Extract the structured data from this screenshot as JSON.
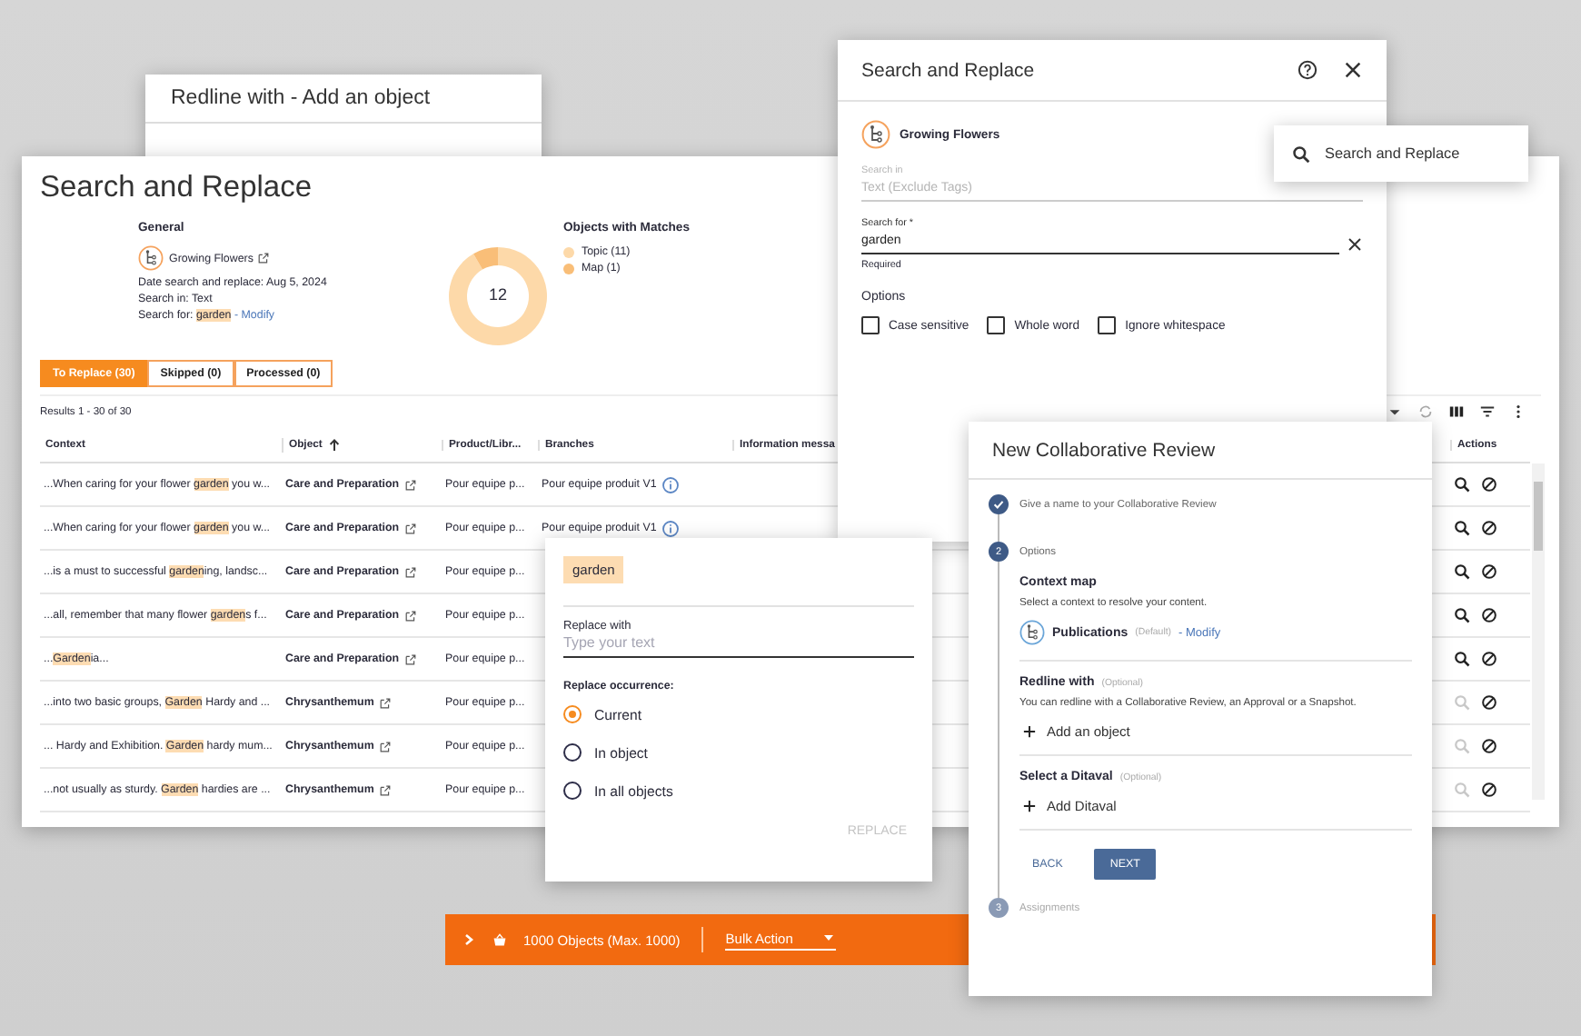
{
  "background_window": {
    "title": "Redline with - Add an object"
  },
  "main": {
    "title": "Search and Replace",
    "general": {
      "heading": "General",
      "map_name": "Growing Flowers",
      "date_line": "Date search and replace: Aug 5, 2024",
      "search_in_line": "Search in: Text",
      "search_for_label": "Search for:",
      "search_for_term": "garden",
      "modify_link": "- Modify"
    },
    "matches": {
      "heading": "Objects with Matches",
      "total": "12",
      "legend": [
        {
          "color": "#fdd9a9"
        },
        {
          "color": "#f9be78"
        }
      ],
      "chart_data": {
        "type": "donut",
        "categories": [
          "Topic (11)",
          "Map (1)"
        ],
        "series": [
          {
            "values": [
              11,
              1
            ]
          }
        ]
      }
    },
    "tabs": [
      {
        "label": "To Replace (30)",
        "selected": true
      },
      {
        "label": "Skipped (0)",
        "selected": false
      },
      {
        "label": "Processed (0)",
        "selected": false
      }
    ],
    "results": "Results 1 - 30 of 30",
    "table": {
      "columns": [
        {
          "label": "Context",
          "sorted": false
        },
        {
          "label": "Object",
          "sorted": true
        },
        {
          "label": "Product/Libr...",
          "sorted": false
        },
        {
          "label": "Branches",
          "sorted": false
        },
        {
          "label": "Information messa",
          "sorted": false
        },
        {
          "label": "Actions",
          "sorted": false
        }
      ],
      "rows": [
        {
          "context": [
            {
              "text": "...When caring for your flower ",
              "highlight": false
            },
            {
              "text": "garden",
              "highlight": true
            },
            {
              "text": " you w...",
              "highlight": false
            }
          ],
          "object": "Care and Preparation",
          "product": "Pour equipe p...",
          "branch": "Pour equipe produit V1",
          "preview_enabled": true
        },
        {
          "context": [
            {
              "text": "...When caring for your flower ",
              "highlight": false
            },
            {
              "text": "garden",
              "highlight": true
            },
            {
              "text": " you w...",
              "highlight": false
            }
          ],
          "object": "Care and Preparation",
          "product": "Pour equipe p...",
          "branch": "Pour equipe produit V1",
          "preview_enabled": true
        },
        {
          "context": [
            {
              "text": "...is a must to successful ",
              "highlight": false
            },
            {
              "text": "garden",
              "highlight": true
            },
            {
              "text": "ing, landsc...",
              "highlight": false
            }
          ],
          "object": "Care and Preparation",
          "product": "Pour equipe p...",
          "preview_enabled": true
        },
        {
          "context": [
            {
              "text": "...all, remember that many flower ",
              "highlight": false
            },
            {
              "text": "garden",
              "highlight": true
            },
            {
              "text": "s f...",
              "highlight": false
            }
          ],
          "object": "Care and Preparation",
          "product": "Pour equipe p...",
          "preview_enabled": true
        },
        {
          "context": [
            {
              "text": "...",
              "highlight": false
            },
            {
              "text": "Garden",
              "highlight": true
            },
            {
              "text": "ia...",
              "highlight": false
            }
          ],
          "object": "Care and Preparation",
          "product": "Pour equipe p...",
          "preview_enabled": true
        },
        {
          "context": [
            {
              "text": "...into two basic groups, ",
              "highlight": false
            },
            {
              "text": "Garden",
              "highlight": true
            },
            {
              "text": " Hardy and ...",
              "highlight": false
            }
          ],
          "object": "Chrysanthemum",
          "product": "Pour equipe p...",
          "preview_enabled": false
        },
        {
          "context": [
            {
              "text": "... Hardy and Exhibition. ",
              "highlight": false
            },
            {
              "text": "Garden",
              "highlight": true
            },
            {
              "text": " hardy mum...",
              "highlight": false
            }
          ],
          "object": "Chrysanthemum",
          "product": "Pour equipe p...",
          "preview_enabled": false
        },
        {
          "context": [
            {
              "text": "...not usually as sturdy. ",
              "highlight": false
            },
            {
              "text": "Garden",
              "highlight": true
            },
            {
              "text": " hardies are ...",
              "highlight": false
            }
          ],
          "object": "Chrysanthemum",
          "product": "Pour equipe p...",
          "preview_enabled": false
        }
      ]
    }
  },
  "search_dialog": {
    "title": "Search and Replace",
    "map_name": "Growing Flowers",
    "search_in": {
      "label": "Search in",
      "value": "Text (Exclude Tags)",
      "disabled": true
    },
    "search_for": {
      "label": "Search for *",
      "value": "garden",
      "hint": "Required",
      "disabled": false
    },
    "options_heading": "Options",
    "options": [
      {
        "label": "Case sensitive",
        "checked": false
      },
      {
        "label": "Whole word",
        "checked": false
      },
      {
        "label": "Ignore whitespace",
        "checked": false
      }
    ]
  },
  "context_menu": {
    "items": [
      {
        "label": "Search and Replace"
      }
    ]
  },
  "replace_popup": {
    "term": "garden",
    "replace_label": "Replace with",
    "placeholder": "Type your text",
    "occurrence_heading": "Replace occurrence:",
    "options": [
      {
        "label": "Current",
        "selected": true
      },
      {
        "label": "In object",
        "selected": false
      },
      {
        "label": "In all objects",
        "selected": false
      }
    ],
    "button": {
      "label": "REPLACE",
      "disabled": true
    }
  },
  "review_dialog": {
    "title": "New Collaborative Review",
    "steps": [
      {
        "kind": "done",
        "label": "Give a name to your Collaborative Review"
      },
      {
        "kind": "active",
        "number": "2",
        "label": "Options"
      },
      {
        "kind": "pending",
        "number": "3",
        "label": "Assignments"
      }
    ],
    "context_map": {
      "heading": "Context map",
      "description": "Select a context to resolve your content.",
      "name": "Publications",
      "default": "(Default)",
      "modify": "- Modify"
    },
    "redline": {
      "heading": "Redline with",
      "optional": "(Optional)",
      "description": "You can redline with a Collaborative Review, an Approval or a Snapshot.",
      "add": "Add an object"
    },
    "ditaval": {
      "heading": "Select a Ditaval",
      "optional": "(Optional)",
      "add": "Add Ditaval"
    },
    "buttons": [
      {
        "label": "BACK",
        "kind": "text"
      },
      {
        "label": "NEXT",
        "kind": "primary"
      }
    ]
  },
  "bulk_bar": {
    "count": "1000 Objects (Max. 1000)",
    "action": "Bulk Action"
  }
}
